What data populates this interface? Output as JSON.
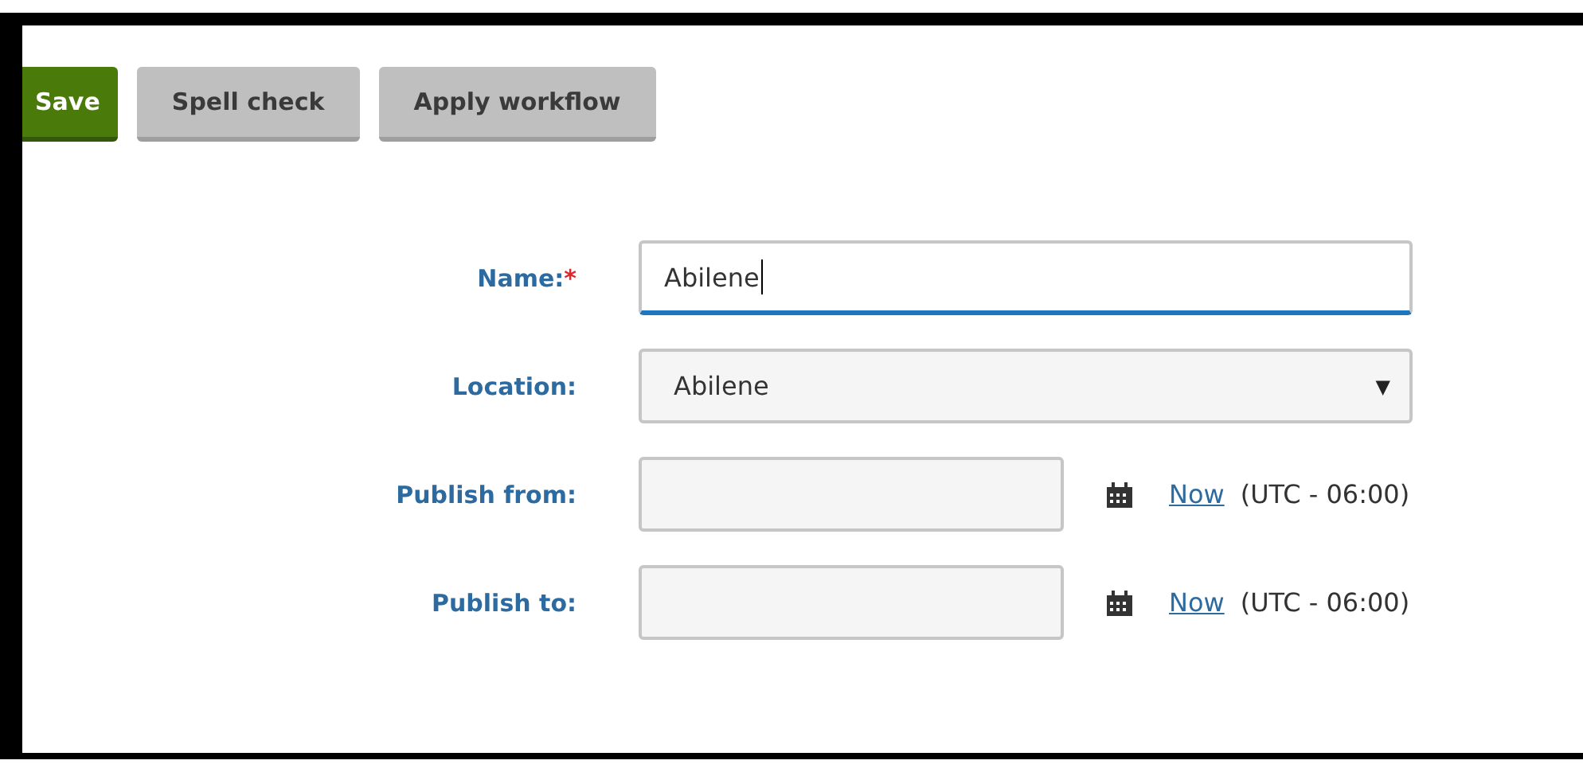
{
  "toolbar": {
    "buttons": [
      {
        "label": "Save",
        "kind": "primary"
      },
      {
        "label": "Spell check",
        "kind": "secondary"
      },
      {
        "label": "Apply workflow",
        "kind": "secondary"
      }
    ]
  },
  "form": {
    "fields": [
      {
        "label": "Name:",
        "required_mark": "*",
        "kind": "text",
        "value": "Abilene",
        "focused": true
      },
      {
        "label": "Location:",
        "kind": "select",
        "value": "Abilene",
        "arrow": "▼"
      },
      {
        "label": "Publish from:",
        "kind": "datetime",
        "link": "Now",
        "timezone": "(UTC - 06:00)"
      },
      {
        "label": "Publish to:",
        "kind": "datetime",
        "link": "Now",
        "timezone": "(UTC - 06:00)"
      }
    ]
  }
}
